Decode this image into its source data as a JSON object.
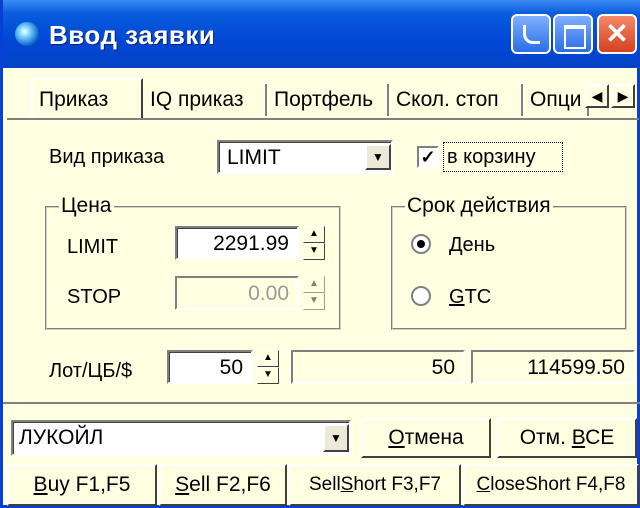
{
  "window": {
    "title": "Ввод заявки"
  },
  "tabs": [
    {
      "label": "Приказ"
    },
    {
      "label": "IQ приказ"
    },
    {
      "label": "Портфель"
    },
    {
      "label": "Скол. стоп"
    },
    {
      "label": "Опци"
    }
  ],
  "order": {
    "type_label": "Вид приказа",
    "type_value": "LIMIT",
    "basket_label": "в корзину",
    "basket_checked": true
  },
  "price": {
    "group_title": "Цена",
    "limit_label": "LIMIT",
    "limit_value": "2291.99",
    "stop_label": "STOP",
    "stop_value": "0.00"
  },
  "validity": {
    "group_title": "Срок действия",
    "day_label_prefix": "Д",
    "day_label_rest": "ень",
    "gtc_label_prefix": "G",
    "gtc_label_rest": "TC",
    "selected": "day"
  },
  "quantity": {
    "label": "Лот/ЦБ/$",
    "value": "50",
    "shares": "50",
    "amount": "114599.50"
  },
  "security": {
    "value": "ЛУКОЙЛ"
  },
  "buttons": {
    "cancel_prefix": "О",
    "cancel_rest": "тмена",
    "cancel_all_start": "Отм. ",
    "cancel_all_ul": "В",
    "cancel_all_end": "СЕ",
    "buy_ul": "B",
    "buy_rest": "uy F1,F5",
    "sell_ul": "S",
    "sell_rest": "ell F2,F6",
    "sellshort_start": "Sell",
    "sellshort_ul": "S",
    "sellshort_end": "hort F3,F7",
    "closeshort_ul": "C",
    "closeshort_rest": "loseShort F4,F8"
  }
}
